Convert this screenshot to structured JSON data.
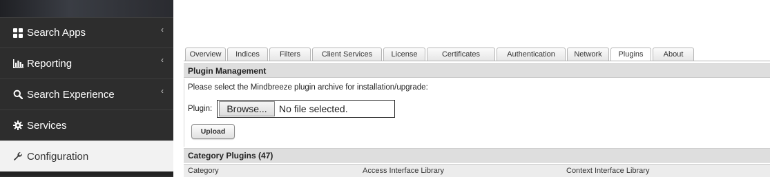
{
  "sidebar": {
    "items": [
      {
        "label": "Search Apps",
        "icon": "grid-icon",
        "has_chevron": true
      },
      {
        "label": "Reporting",
        "icon": "bar-chart-icon",
        "has_chevron": true
      },
      {
        "label": "Search Experience",
        "icon": "search-icon",
        "has_chevron": true
      },
      {
        "label": "Services",
        "icon": "gear-icon",
        "has_chevron": false
      },
      {
        "label": "Configuration",
        "icon": "wrench-icon",
        "has_chevron": false,
        "active": true
      }
    ],
    "chevron": "‹"
  },
  "tabs": [
    {
      "label": "Overview"
    },
    {
      "label": "Indices"
    },
    {
      "label": "Filters"
    },
    {
      "label": "Client Services"
    },
    {
      "label": "License"
    },
    {
      "label": "Certificates"
    },
    {
      "label": "Authentication"
    },
    {
      "label": "Network"
    },
    {
      "label": "Plugins",
      "active": true
    },
    {
      "label": "About"
    }
  ],
  "plugin_management": {
    "title": "Plugin Management",
    "instruction": "Please select the Mindbreeze plugin archive for installation/upgrade:",
    "plugin_label": "Plugin:",
    "browse_label": "Browse...",
    "file_status": "No file selected.",
    "upload_label": "Upload"
  },
  "category_plugins": {
    "title": "Category Plugins (47)",
    "columns": [
      "Category",
      "Access Interface Library",
      "Context Interface Library"
    ]
  },
  "colors": {
    "sidebar_bg": "#2d2d2d",
    "sidebar_active_bg": "#f2f2f2",
    "panel_header_bg": "#dedede"
  }
}
